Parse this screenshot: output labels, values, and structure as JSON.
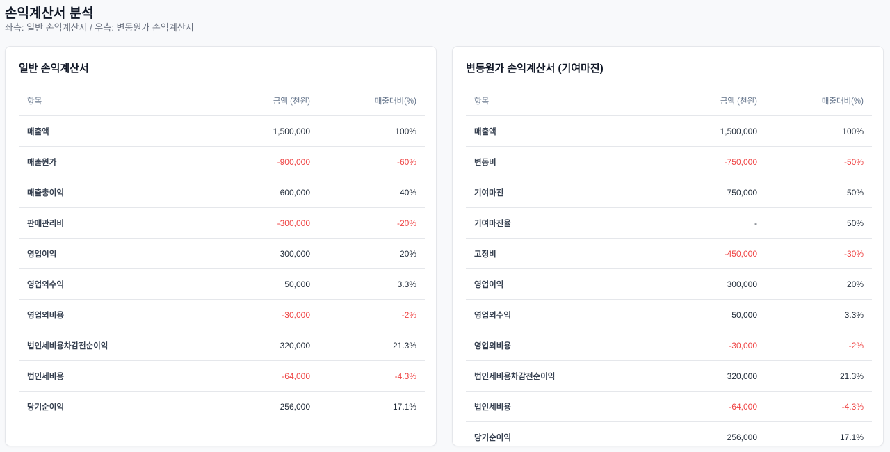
{
  "page": {
    "title": "손익계산서 분석",
    "subtitle": "좌측: 일반 손익계산서 / 우측: 변동원가 손익계산서"
  },
  "colors": {
    "negative": "#ef4444"
  },
  "tables": [
    {
      "title": "일반 손익계산서",
      "headers": [
        "항목",
        "금액 (천원)",
        "매출대비(%)"
      ],
      "rows": [
        [
          "매출액",
          "1,500,000",
          "100%"
        ],
        [
          "매출원가",
          "-900,000",
          "-60%"
        ],
        [
          "매출총이익",
          "600,000",
          "40%"
        ],
        [
          "판매관리비",
          "-300,000",
          "-20%"
        ],
        [
          "영업이익",
          "300,000",
          "20%"
        ],
        [
          "영업외수익",
          "50,000",
          "3.3%"
        ],
        [
          "영업외비용",
          "-30,000",
          "-2%"
        ],
        [
          "법인세비용차감전순이익",
          "320,000",
          "21.3%"
        ],
        [
          "법인세비용",
          "-64,000",
          "-4.3%"
        ],
        [
          "당기순이익",
          "256,000",
          "17.1%"
        ]
      ]
    },
    {
      "title": "변동원가 손익계산서 (기여마진)",
      "headers": [
        "항목",
        "금액 (천원)",
        "매출대비(%)"
      ],
      "rows": [
        [
          "매출액",
          "1,500,000",
          "100%"
        ],
        [
          "변동비",
          "-750,000",
          "-50%"
        ],
        [
          "기여마진",
          "750,000",
          "50%"
        ],
        [
          "기여마진율",
          "-",
          "50%"
        ],
        [
          "고정비",
          "-450,000",
          "-30%"
        ],
        [
          "영업이익",
          "300,000",
          "20%"
        ],
        [
          "영업외수익",
          "50,000",
          "3.3%"
        ],
        [
          "영업외비용",
          "-30,000",
          "-2%"
        ],
        [
          "법인세비용차감전순이익",
          "320,000",
          "21.3%"
        ],
        [
          "법인세비용",
          "-64,000",
          "-4.3%"
        ],
        [
          "당기순이익",
          "256,000",
          "17.1%"
        ]
      ]
    }
  ]
}
